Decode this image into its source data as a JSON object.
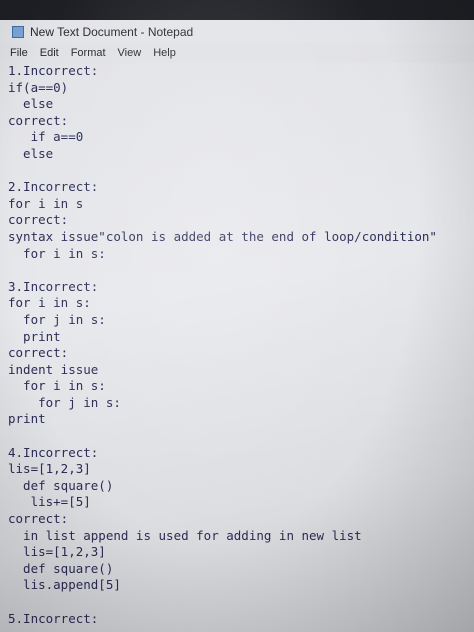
{
  "window": {
    "title": "New Text Document - Notepad",
    "icon": "notepad-icon"
  },
  "menu": {
    "items": [
      "File",
      "Edit",
      "Format",
      "View",
      "Help"
    ]
  },
  "editor": {
    "lines": [
      "1.Incorrect:",
      "if(a==0)",
      "  else",
      "correct:",
      "   if a==0",
      "  else",
      "",
      "2.Incorrect:",
      "for i in s",
      "correct:",
      "syntax issue\"colon is added at the end of loop/condition\"",
      "  for i in s:",
      "",
      "3.Incorrect:",
      "for i in s:",
      "  for j in s:",
      "  print",
      "correct:",
      "indent issue",
      "  for i in s:",
      "    for j in s:",
      "print",
      "",
      "4.Incorrect:",
      "lis=[1,2,3]",
      "  def square()",
      "   lis+=[5]",
      "correct:",
      "  in list append is used for adding in new list",
      "  lis=[1,2,3]",
      "  def square()",
      "  lis.append[5]",
      "",
      "5.Incorrect:"
    ]
  }
}
